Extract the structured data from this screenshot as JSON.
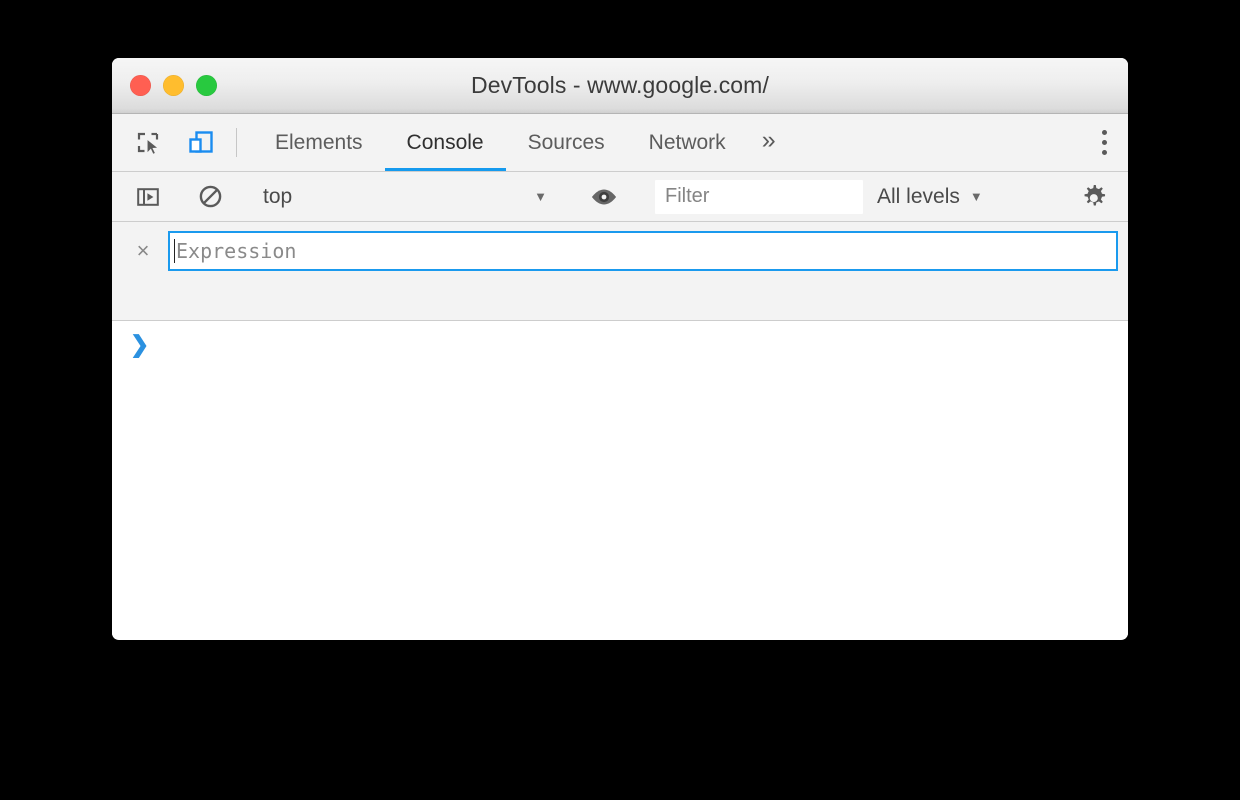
{
  "window": {
    "title": "DevTools - www.google.com/",
    "traffic_lights": [
      {
        "name": "close",
        "color": "#ff5f52"
      },
      {
        "name": "minimize",
        "color": "#ffbd2e"
      },
      {
        "name": "maximize",
        "color": "#28c93f"
      }
    ]
  },
  "tab_bar": {
    "icons": [
      {
        "name": "inspect-element-icon",
        "state": "inactive",
        "color": "#5a5a5a"
      },
      {
        "name": "device-toolbar-icon",
        "state": "active",
        "color": "#1a8cf0"
      }
    ],
    "tabs": [
      {
        "label": "Elements",
        "active": false
      },
      {
        "label": "Console",
        "active": true
      },
      {
        "label": "Sources",
        "active": false
      },
      {
        "label": "Network",
        "active": false
      }
    ],
    "overflow_label": "»",
    "main_menu": {
      "name": "more-options-icon",
      "dots": 3
    },
    "active_tab_underline_color": "#159aee"
  },
  "console_toolbar": {
    "sidebar_toggle": {
      "name": "console-sidebar-icon"
    },
    "clear_console": {
      "name": "clear-console-icon"
    },
    "context": {
      "value": "top",
      "caret": "▼"
    },
    "live_expression_button": {
      "name": "eye-icon"
    },
    "filter": {
      "value": "",
      "placeholder": "Filter"
    },
    "levels": {
      "value": "All levels",
      "caret": "▼"
    },
    "settings_button": {
      "name": "gear-icon"
    }
  },
  "pinned_pane": {
    "live_expression": {
      "remove_label": "×",
      "value": "",
      "placeholder": "Expression",
      "focused": true,
      "focus_color": "#1a9aee"
    }
  },
  "console_body": {
    "prompt_chevron": "❯",
    "input_value": "",
    "messages": []
  }
}
